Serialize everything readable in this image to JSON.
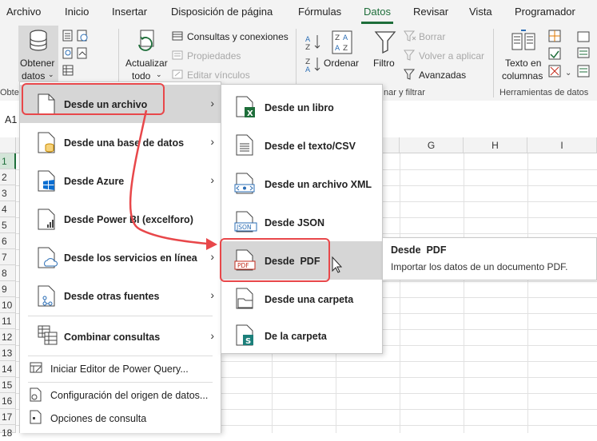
{
  "tabs": [
    "Archivo",
    "Inicio",
    "Insertar",
    "Disposición de página",
    "Fórmulas",
    "Datos",
    "Revisar",
    "Vista",
    "Programador"
  ],
  "ribbon": {
    "get_data": [
      "Obtener",
      "datos"
    ],
    "refresh": [
      "Actualizar",
      "todo"
    ],
    "queries_connections": "Consultas y conexiones",
    "properties": "Propiedades",
    "edit_links": "Editar vínculos",
    "sort": "Ordenar",
    "filter": "Filtro",
    "clear": "Borrar",
    "reapply": "Volver a aplicar",
    "advanced": "Avanzadas",
    "text_to_columns": [
      "Texto en",
      "columnas"
    ],
    "group_partial_left": "Obte",
    "group_sort_filter": "nar y filtrar",
    "group_data_tools": "Herramientas de datos"
  },
  "name_box": "A1",
  "columns": [
    "G",
    "H",
    "I"
  ],
  "rows": [
    "1",
    "2",
    "3",
    "4",
    "5",
    "6",
    "7",
    "8",
    "9",
    "10",
    "11",
    "12",
    "13",
    "14",
    "15",
    "16",
    "17",
    "18"
  ],
  "menu_main": {
    "items": [
      {
        "label": "Desde un archivo",
        "icon": "file-icon"
      },
      {
        "label": "Desde una base de datos",
        "icon": "database-icon"
      },
      {
        "label": "Desde Azure",
        "icon": "azure-icon"
      },
      {
        "label": "Desde Power BI (excelforo)",
        "icon": "power-bi-icon"
      },
      {
        "label": "Desde los servicios en línea",
        "icon": "online-services-icon"
      },
      {
        "label": "Desde otras fuentes",
        "icon": "other-sources-icon"
      },
      {
        "label": "Combinar consultas",
        "icon": "combine-queries-icon"
      }
    ],
    "plain_items": [
      {
        "label": "Iniciar Editor de Power Query...",
        "icon": "power-query-editor-icon"
      },
      {
        "label": "Configuración del origen de datos...",
        "icon": "data-source-settings-icon"
      },
      {
        "label": "Opciones de consulta",
        "icon": "query-options-icon"
      }
    ]
  },
  "menu_sub": {
    "items": [
      {
        "label": "Desde un libro",
        "icon": "excel-workbook-icon",
        "badge": "X"
      },
      {
        "label": "Desde el texto/CSV",
        "icon": "text-csv-icon"
      },
      {
        "label": "Desde un archivo XML",
        "icon": "xml-file-icon"
      },
      {
        "label": "Desde JSON",
        "icon": "json-file-icon",
        "badge": "JSON"
      },
      {
        "label": "Desde  PDF",
        "icon": "pdf-file-icon",
        "badge": "PDF"
      },
      {
        "label": "Desde una carpeta",
        "icon": "folder-icon"
      },
      {
        "label": "De la carpeta",
        "icon": "sharepoint-folder-icon",
        "badge": "S"
      }
    ]
  },
  "tooltip": {
    "title": "Desde  PDF",
    "description": "Importar los datos de un documento PDF."
  },
  "colors": {
    "excel_green": "#1e6e3a",
    "highlight": "#e8474a",
    "menu_hover": "#d6d6d6"
  }
}
